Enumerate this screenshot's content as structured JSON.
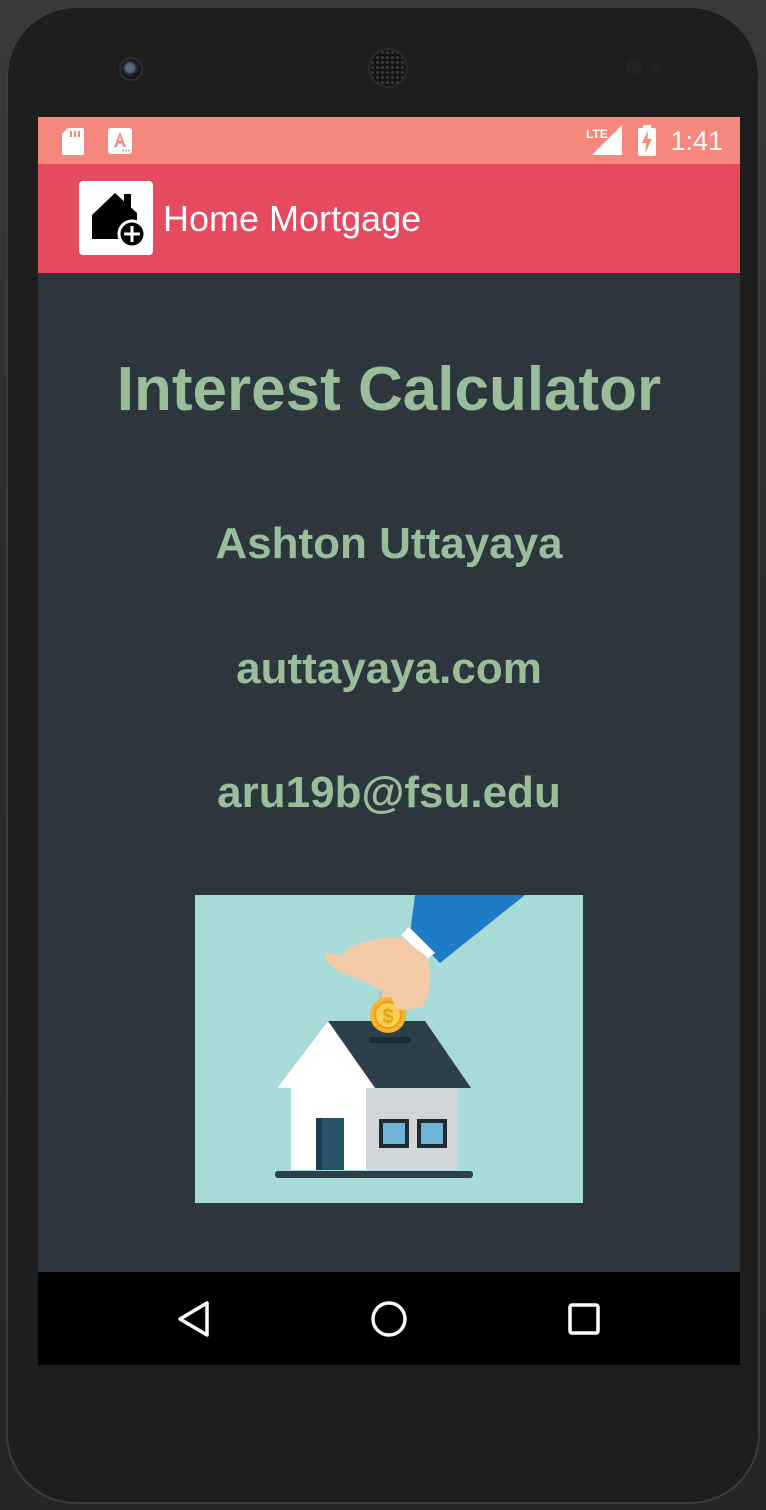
{
  "status_bar": {
    "time": "1:41",
    "network": "LTE",
    "icons": [
      "sd-card-icon",
      "app-notification-icon",
      "lte-signal-icon",
      "battery-charging-icon"
    ]
  },
  "app_bar": {
    "title": "Home Mortgage",
    "logo_icon": "home-add-icon"
  },
  "main": {
    "title": "Interest Calculator",
    "author": "Ashton Uttayaya",
    "website": "auttayaya.com",
    "email": "aru19b@fsu.edu",
    "illustration": "house-piggy-bank-coin-illustration",
    "coin_symbol": "$"
  },
  "nav_bar": {
    "buttons": [
      "back-icon",
      "home-icon",
      "recents-icon"
    ]
  },
  "colors": {
    "status_bar": "#f5877c",
    "app_bar": "#e64a5f",
    "background": "#2c363c",
    "text_accent": "#9bbd9a",
    "illustration_bg": "#a6dbd7"
  }
}
